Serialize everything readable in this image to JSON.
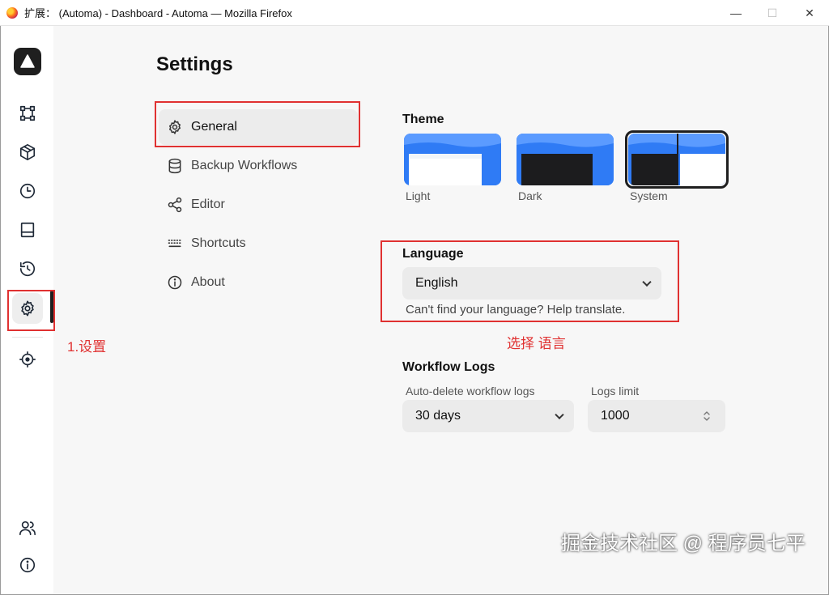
{
  "window": {
    "title": "扩展： (Automa) - Dashboard - Automa — Mozilla Firefox",
    "minimize": "—",
    "maximize": "☐",
    "close": "✕"
  },
  "sidebar": {
    "items": [
      {
        "name": "workflows",
        "icon": "workflow-icon"
      },
      {
        "name": "packages",
        "icon": "package-icon"
      },
      {
        "name": "schedule",
        "icon": "clock-icon"
      },
      {
        "name": "storage",
        "icon": "storage-icon"
      },
      {
        "name": "logs",
        "icon": "history-icon"
      },
      {
        "name": "settings",
        "icon": "gear-icon",
        "active": true
      },
      {
        "name": "element-selector",
        "icon": "crosshair-icon"
      },
      {
        "name": "team",
        "icon": "users-icon"
      },
      {
        "name": "about",
        "icon": "info-icon"
      }
    ]
  },
  "annotations": {
    "settings_note": "1.设置",
    "language_note": "选择 语言"
  },
  "page": {
    "title": "Settings"
  },
  "nav": [
    {
      "label": "General",
      "icon": "gear-icon",
      "active": true
    },
    {
      "label": "Backup Workflows",
      "icon": "database-icon"
    },
    {
      "label": "Editor",
      "icon": "share-icon"
    },
    {
      "label": "Shortcuts",
      "icon": "keyboard-icon"
    },
    {
      "label": "About",
      "icon": "info-icon"
    }
  ],
  "theme": {
    "label": "Theme",
    "options": [
      {
        "label": "Light"
      },
      {
        "label": "Dark"
      },
      {
        "label": "System",
        "selected": true
      }
    ]
  },
  "language": {
    "label": "Language",
    "selected": "English",
    "help": "Can't find your language? Help translate."
  },
  "workflow_logs": {
    "label": "Workflow Logs",
    "auto_delete_label": "Auto-delete workflow logs",
    "auto_delete_value": "30 days",
    "logs_limit_label": "Logs limit",
    "logs_limit_value": "1000"
  },
  "watermark": "掘金技术社区 @ 程序员七平",
  "colors": {
    "accent": "#3b82f6",
    "annotation": "#e03131",
    "dark": "#1f1f1f"
  }
}
